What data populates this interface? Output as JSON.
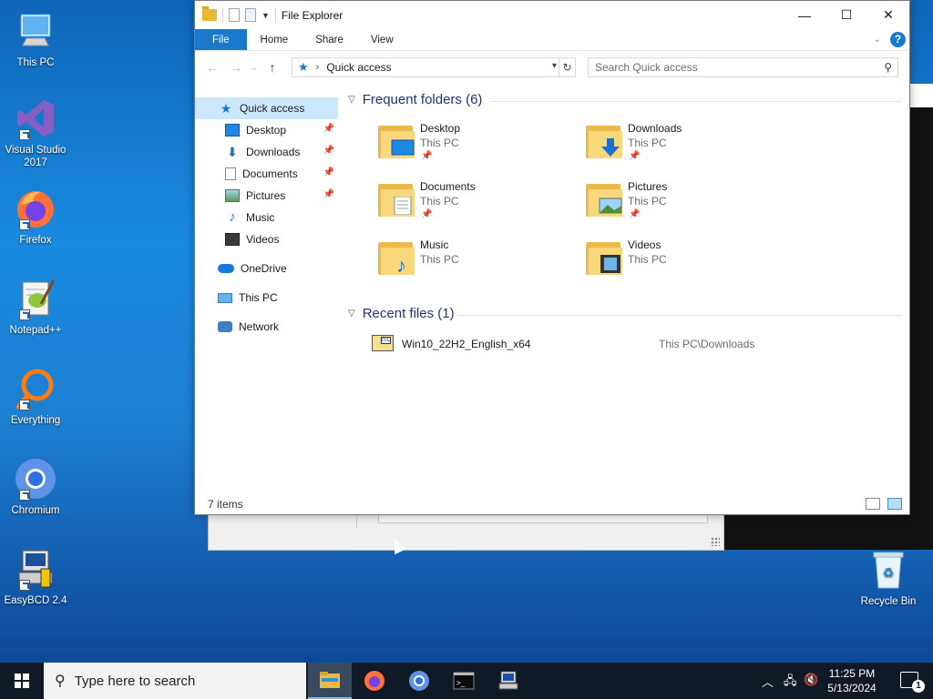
{
  "desktop": {
    "icons": [
      {
        "label": "This PC",
        "icon": "this-pc-icon"
      },
      {
        "label": "Visual Studio 2017",
        "icon": "visual-studio-icon"
      },
      {
        "label": "Firefox",
        "icon": "firefox-icon"
      },
      {
        "label": "Notepad++",
        "icon": "notepadpp-icon"
      },
      {
        "label": "Everything",
        "icon": "everything-icon"
      },
      {
        "label": "Chromium",
        "icon": "chromium-icon"
      },
      {
        "label": "EasyBCD 2.4",
        "icon": "easybcd-icon"
      },
      {
        "label": "Recycle Bin",
        "icon": "recycle-bin-icon"
      }
    ]
  },
  "explorer": {
    "title": "File Explorer",
    "ribbon_tabs": [
      "File",
      "Home",
      "Share",
      "View"
    ],
    "help_label": "?",
    "address": {
      "path": "Quick access"
    },
    "search": {
      "placeholder": "Search Quick access"
    },
    "nav": [
      {
        "label": "Quick access",
        "icon": "star-icon",
        "pinned": false,
        "selected": true
      },
      {
        "label": "Desktop",
        "icon": "desktop-icon",
        "pinned": true
      },
      {
        "label": "Downloads",
        "icon": "download-icon",
        "pinned": true
      },
      {
        "label": "Documents",
        "icon": "documents-icon",
        "pinned": true
      },
      {
        "label": "Pictures",
        "icon": "pictures-icon",
        "pinned": true
      },
      {
        "label": "Music",
        "icon": "music-icon",
        "pinned": false
      },
      {
        "label": "Videos",
        "icon": "videos-icon",
        "pinned": false
      },
      {
        "label": "OneDrive",
        "icon": "onedrive-icon",
        "pinned": false
      },
      {
        "label": "This PC",
        "icon": "this-pc-icon",
        "pinned": false
      },
      {
        "label": "Network",
        "icon": "network-icon",
        "pinned": false
      }
    ],
    "frequent": {
      "heading": "Frequent folders (6)",
      "folders": [
        {
          "name": "Desktop",
          "location": "This PC",
          "pinned": true
        },
        {
          "name": "Downloads",
          "location": "This PC",
          "pinned": true
        },
        {
          "name": "Documents",
          "location": "This PC",
          "pinned": true
        },
        {
          "name": "Pictures",
          "location": "This PC",
          "pinned": true
        },
        {
          "name": "Music",
          "location": "This PC",
          "pinned": false
        },
        {
          "name": "Videos",
          "location": "This PC",
          "pinned": false
        }
      ]
    },
    "recent": {
      "heading": "Recent files (1)",
      "files": [
        {
          "name": "Win10_22H2_English_x64",
          "path": "This PC\\Downloads",
          "badge": "ISO"
        }
      ]
    },
    "status": {
      "items": "7 items"
    }
  },
  "taskbar": {
    "search_placeholder": "Type here to search",
    "apps": [
      "file-explorer-icon",
      "firefox-icon",
      "chromium-icon",
      "terminal-icon",
      "easybcd-icon"
    ],
    "clock": {
      "time": "11:25 PM",
      "date": "5/13/2024"
    },
    "notifications": "1"
  }
}
